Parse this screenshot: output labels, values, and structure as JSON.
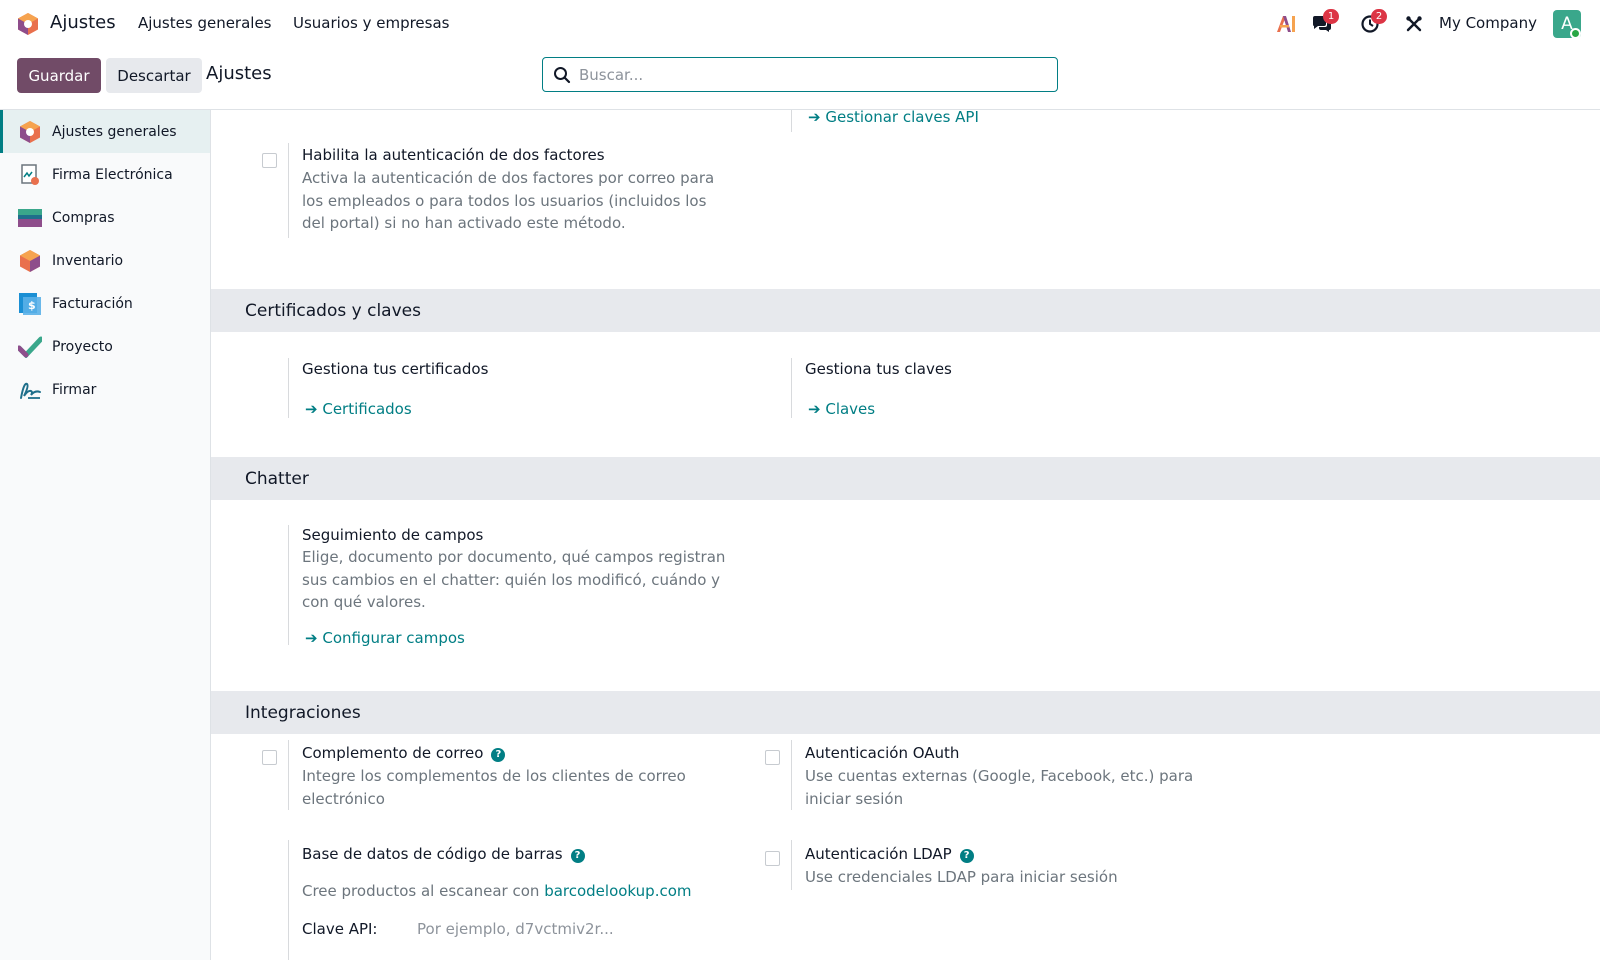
{
  "navbar": {
    "app_name": "Ajustes",
    "menus": [
      "Ajustes generales",
      "Usuarios y empresas"
    ],
    "messages_count": "1",
    "activities_count": "2",
    "company": "My Company",
    "avatar_letter": "A"
  },
  "control_panel": {
    "save_label": "Guardar",
    "discard_label": "Descartar",
    "breadcrumb": "Ajustes",
    "search_placeholder": "Buscar..."
  },
  "sidebar": {
    "items": [
      {
        "label": "Ajustes generales",
        "icon": "settings-app-icon",
        "active": true
      },
      {
        "label": "Firma Electrónica",
        "icon": "electronic-signature-icon"
      },
      {
        "label": "Compras",
        "icon": "purchase-icon"
      },
      {
        "label": "Inventario",
        "icon": "inventory-icon"
      },
      {
        "label": "Facturación",
        "icon": "invoicing-icon"
      },
      {
        "label": "Proyecto",
        "icon": "project-icon"
      },
      {
        "label": "Firmar",
        "icon": "sign-icon"
      }
    ]
  },
  "content": {
    "api_keys_link": "Gestionar claves API",
    "two_factor": {
      "title": "Habilita la autenticación de dos factores",
      "desc": [
        "Activa la autenticación de dos factores por correo para",
        "los empleados o para todos los usuarios (incluidos los",
        "del portal) si no han activado este método."
      ]
    },
    "certificates_section": {
      "heading": "Certificados y claves",
      "certificates": {
        "title": "Gestiona tus certificados",
        "link": "Certificados"
      },
      "keys": {
        "title": "Gestiona tus claves",
        "link": "Claves"
      }
    },
    "chatter_section": {
      "heading": "Chatter",
      "tracking": {
        "title": "Seguimiento de campos",
        "desc": [
          "Elige, documento por documento, qué campos registran",
          "sus cambios en el chatter: quién los modificó, cuándo y",
          "con qué valores."
        ],
        "link": "Configurar campos"
      }
    },
    "integrations_section": {
      "heading": "Integraciones",
      "mail_plugin": {
        "title": "Complemento de correo",
        "desc": [
          "Integre los complementos de los clientes de correo",
          "electrónico"
        ]
      },
      "oauth": {
        "title": "Autenticación OAuth",
        "desc": [
          "Use cuentas externas (Google, Facebook, etc.) para",
          "iniciar sesión"
        ]
      },
      "barcode": {
        "title": "Base de datos de código de barras",
        "desc_prefix": "Cree productos al escanear con",
        "desc_link": "barcodelookup.com",
        "api_label": "Clave API:",
        "api_placeholder": "Por ejemplo, d7vctmiv2r..."
      },
      "ldap": {
        "title": "Autenticación LDAP",
        "desc": "Use credenciales LDAP para iniciar sesión"
      }
    }
  },
  "colors": {
    "brand": "#714b67",
    "accent": "#017e84",
    "section_bg": "#e7e9ed"
  }
}
